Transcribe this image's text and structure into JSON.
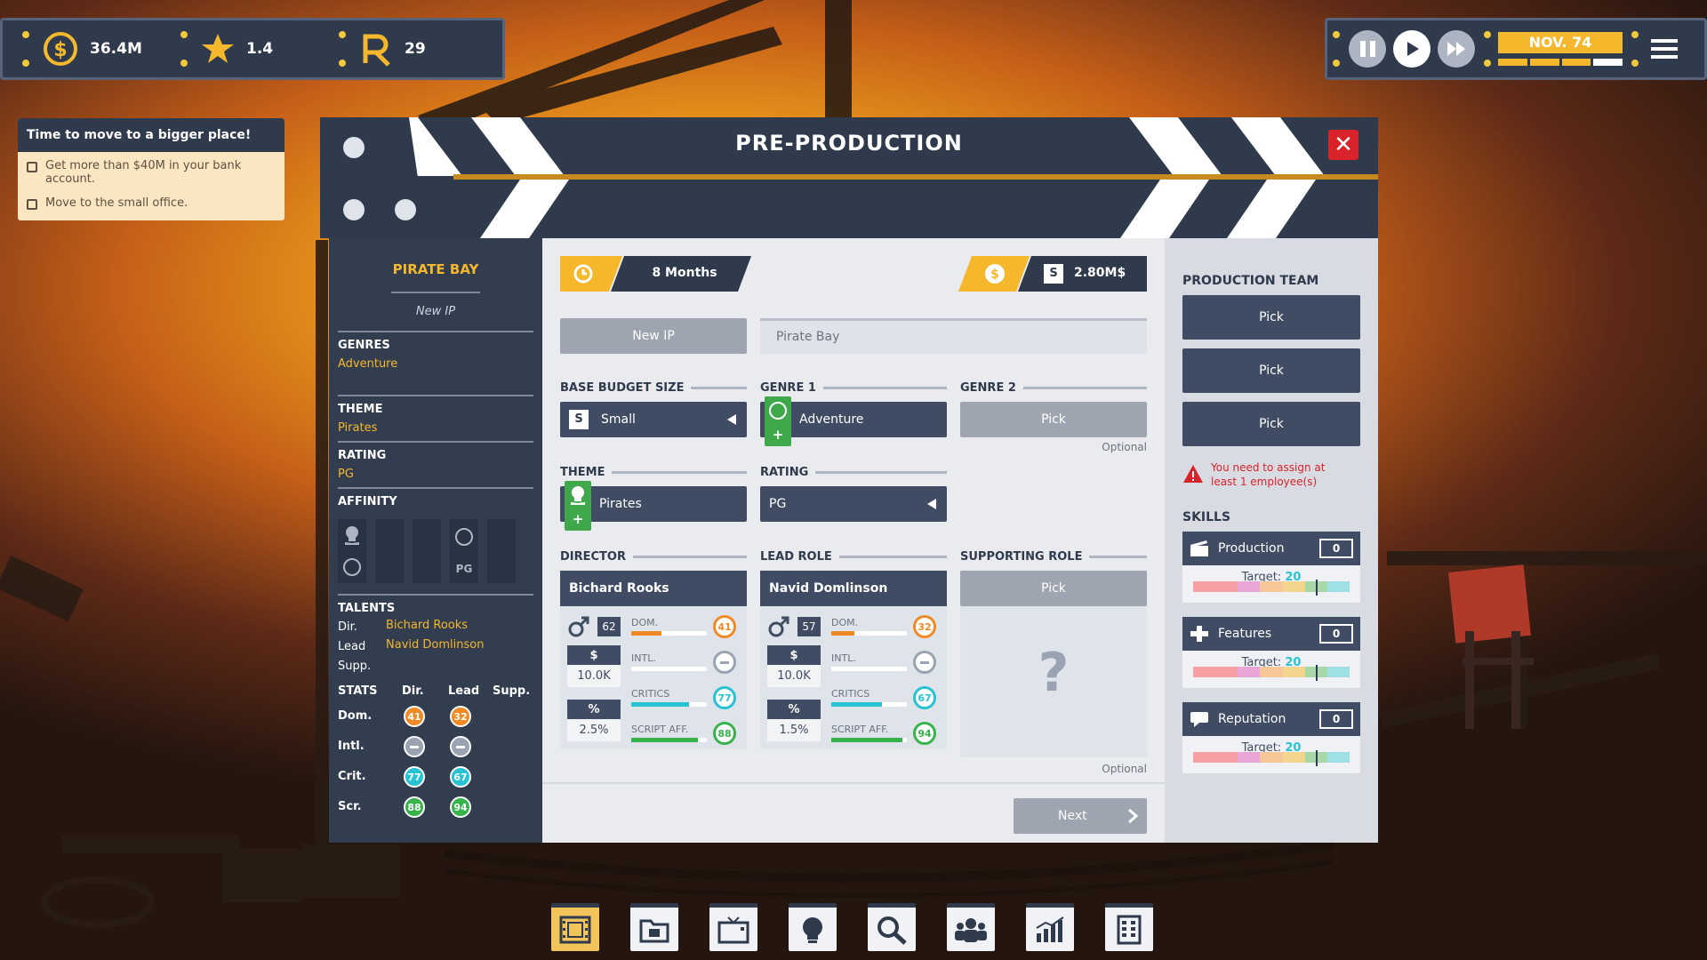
{
  "hud": {
    "money": "36.4M",
    "rating": "1.4",
    "followers": "29",
    "date": "NOV. 74"
  },
  "objectives": {
    "title": "Time to move to a bigger place!",
    "items": [
      "Get more than $40M in your bank account.",
      "Move to the small office."
    ]
  },
  "modal": {
    "title": "PRE-PRODUCTION",
    "close": "✕"
  },
  "summary": {
    "movie_title": "PIRATE BAY",
    "ip": "New IP",
    "genres_label": "GENRES",
    "genres_value": "Adventure",
    "theme_label": "THEME",
    "theme_value": "Pirates",
    "rating_label": "RATING",
    "rating_value": "PG",
    "affinity_label": "AFFINITY",
    "affinity_pg": "PG",
    "talents_label": "TALENTS",
    "dir_label": "Dir.",
    "dir_value": "Bichard Rooks",
    "lead_label": "Lead",
    "lead_value": "Navid Domlinson",
    "supp_label": "Supp.",
    "stats_label": "STATS",
    "stats_cols": [
      "Dir.",
      "Lead",
      "Supp."
    ],
    "stats_rows": [
      "Dom.",
      "Intl.",
      "Crit.",
      "Scr."
    ],
    "dir_stats": [
      "41",
      "",
      "77",
      "88"
    ],
    "lead_stats": [
      "32",
      "",
      "67",
      "94"
    ]
  },
  "center": {
    "duration": "8 Months",
    "budget_tier": "S",
    "budget": "2.80M$",
    "new_ip_btn": "New IP",
    "title_input": "Pirate Bay",
    "base_budget_label": "BASE BUDGET SIZE",
    "base_budget_tier": "S",
    "base_budget_value": "Small",
    "genre1_label": "GENRE 1",
    "genre1_value": "Adventure",
    "genre2_label": "GENRE 2",
    "genre2_value": "Pick",
    "optional": "Optional",
    "theme_label": "THEME",
    "theme_value": "Pirates",
    "rating_label": "RATING",
    "rating_value": "PG",
    "director_label": "DIRECTOR",
    "lead_label": "LEAD ROLE",
    "support_label": "SUPPORTING ROLE",
    "support_pick": "Pick",
    "support_q": "?",
    "optional2": "Optional",
    "next": "Next",
    "director": {
      "name": "Bichard Rooks",
      "age": "62",
      "salary_sym": "$",
      "salary": "10.0K",
      "pct_sym": "%",
      "pct": "2.5%",
      "dom_label": "DOM.",
      "intl_label": "INTL.",
      "critics_label": "CRITICS",
      "script_label": "SCRIPT AFF.",
      "dom": "41",
      "critics": "77",
      "script": "88",
      "dom_pct": 0.4,
      "critics_pct": 0.77,
      "script_pct": 0.88
    },
    "lead": {
      "name": "Navid Domlinson",
      "age": "57",
      "salary_sym": "$",
      "salary": "10.0K",
      "pct_sym": "%",
      "pct": "1.5%",
      "dom_label": "DOM.",
      "intl_label": "INTL.",
      "critics_label": "CRITICS",
      "script_label": "SCRIPT AFF.",
      "dom": "32",
      "critics": "67",
      "script": "94",
      "dom_pct": 0.3,
      "critics_pct": 0.67,
      "script_pct": 0.94
    }
  },
  "team": {
    "label": "PRODUCTION TEAM",
    "pick": "Pick",
    "warning": "You need to assign at least 1 employee(s)",
    "skills_label": "SKILLS",
    "target_label": "Target:",
    "target_value": "20",
    "skills": [
      {
        "name": "Production",
        "value": "0"
      },
      {
        "name": "Features",
        "value": "0"
      },
      {
        "name": "Reputation",
        "value": "0"
      }
    ]
  },
  "colors": {
    "panel": "#2f3a4d",
    "accent": "#f5b82d",
    "danger": "#d8232a"
  }
}
